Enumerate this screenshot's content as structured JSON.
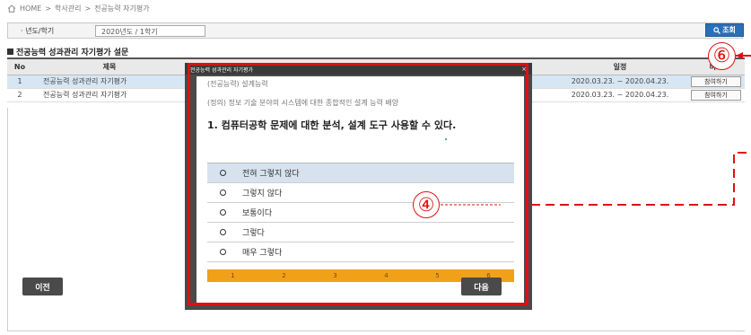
{
  "breadcrumb": {
    "home": "HOME",
    "sep1": ">",
    "level1": "학사관리",
    "sep2": ">",
    "level2": "전공능력 자기평가"
  },
  "filter": {
    "label": "· 년도/학기",
    "value": "2020년도 / 1학기"
  },
  "search": {
    "label": "조회",
    "icon": "magnifier-icon"
  },
  "section": {
    "title": "전공능력 성과관리 자기평가 설문"
  },
  "table": {
    "headers": {
      "no": "No",
      "title": "제목",
      "date": "일정",
      "action": "비고"
    },
    "rows": [
      {
        "no": "1",
        "title": "전공능력 성과관리 자기평가",
        "date": "2020.03.23. ~ 2020.04.23.",
        "action": "참여하기"
      },
      {
        "no": "2",
        "title": "전공능력 성과관리 자기평가",
        "date": "2020.03.23. ~ 2020.04.23.",
        "action": "참여하기"
      }
    ]
  },
  "modal": {
    "title": "전공능력 성과관리 자기평가",
    "close": "×",
    "capability": "(전공능력) 설계능력",
    "definition": "(정의) 정보 기술 분야의 시스템에 대한 종합적인 설계 능력 배양",
    "question": "1. 컴퓨터공학 문제에 대한 분석, 설계 도구 사용할 수 있다.",
    "options": [
      "전혀 그렇지 않다",
      "그렇지 않다",
      "보통이다",
      "그렇다",
      "매우 그렇다"
    ],
    "steps": [
      "1",
      "2",
      "3",
      "4",
      "5",
      "6"
    ],
    "prev": "이전",
    "next": "다음"
  },
  "annotations": {
    "marker_4": "④",
    "marker_6": "⑥"
  },
  "colors": {
    "accent_blue": "#2a6fb8",
    "annotation_red": "#e01010",
    "progress_orange": "#f1a01a",
    "selected_row": "#d7e6f3"
  }
}
